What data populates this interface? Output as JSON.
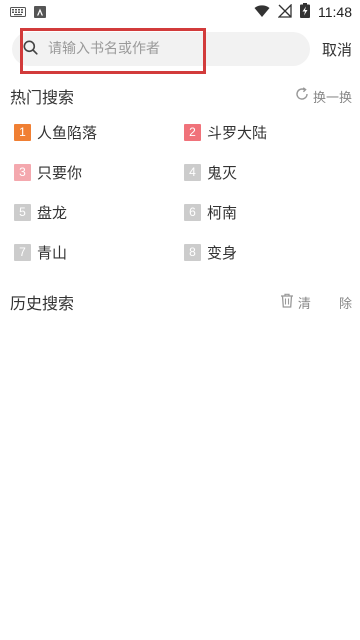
{
  "status_bar": {
    "time": "11:48",
    "left_icons": [
      "keyboard-icon",
      "app-notification-icon"
    ],
    "right_icons": [
      "wifi-icon",
      "no-signal-icon",
      "battery-charging-icon"
    ]
  },
  "search": {
    "placeholder": "请输入书名或作者",
    "value": "",
    "cancel_label": "取消",
    "highlight_color": "#d23b3b"
  },
  "hot_search": {
    "title": "热门搜索",
    "refresh_label": "换一换",
    "items": [
      {
        "rank": "1",
        "label": "人鱼陷落",
        "badge_color": "#f07f33"
      },
      {
        "rank": "2",
        "label": "斗罗大陆",
        "badge_color": "#f0727a"
      },
      {
        "rank": "3",
        "label": "只要你",
        "badge_color": "#f4a8ae"
      },
      {
        "rank": "4",
        "label": "鬼灭",
        "badge_color": "#cccccc"
      },
      {
        "rank": "5",
        "label": "盘龙",
        "badge_color": "#cccccc"
      },
      {
        "rank": "6",
        "label": "柯南",
        "badge_color": "#cccccc"
      },
      {
        "rank": "7",
        "label": "青山",
        "badge_color": "#cccccc"
      },
      {
        "rank": "8",
        "label": "变身",
        "badge_color": "#cccccc"
      }
    ]
  },
  "history": {
    "title": "历史搜索",
    "clear_label": "清 除"
  }
}
